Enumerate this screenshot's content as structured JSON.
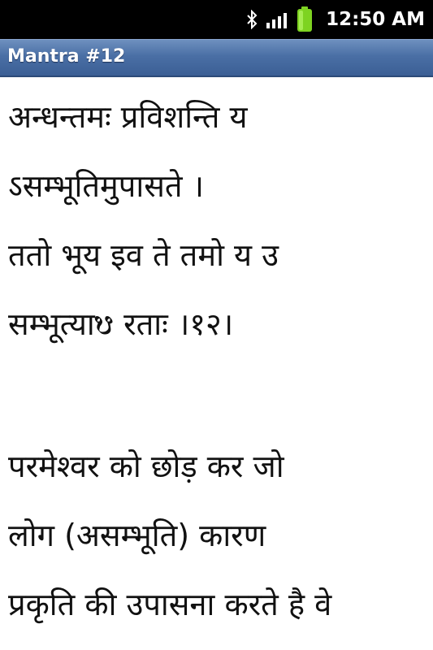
{
  "status_bar": {
    "time": "12:50 AM",
    "icons": [
      "bluetooth-icon",
      "signal-icon",
      "battery-icon"
    ],
    "battery_color": "#7ed321"
  },
  "title_bar": {
    "title": "Mantra #12"
  },
  "content": {
    "mantra_lines": [
      "अन्धन्तमः प्रविशन्ति य",
      "ऽसम्भूतिमुपासते ।",
      "ततो भूय इव ते तमो य उ",
      "सम्भूत्याᳪ रताः ।१२।"
    ],
    "meaning_lines": [
      "परमेश्वर को छोड़ कर जो",
      "लोग (असम्भूति) कारण",
      "प्रकृति की उपासना करते है वे"
    ]
  }
}
